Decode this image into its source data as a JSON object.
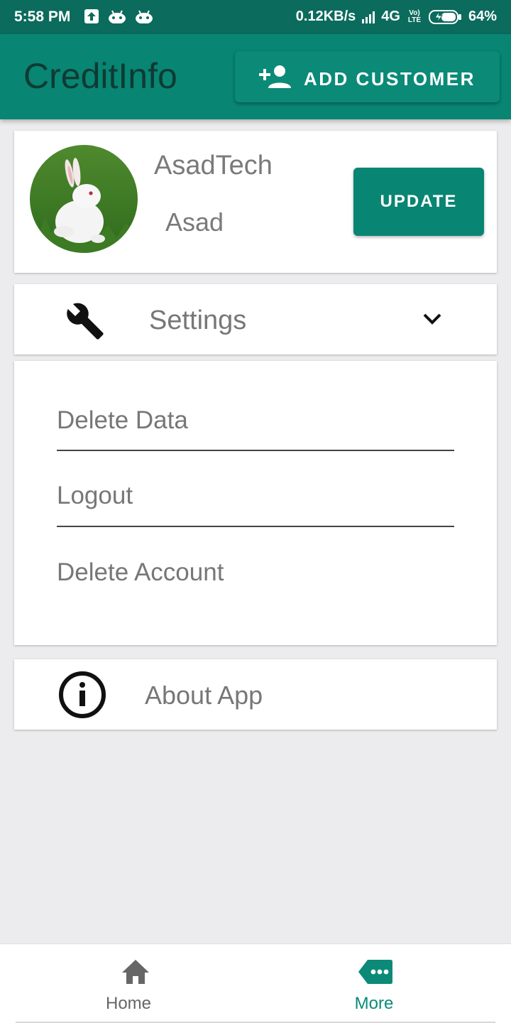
{
  "status_bar": {
    "time": "5:58 PM",
    "network_speed": "0.12KB/s",
    "network_type": "4G",
    "volte": "Vo) LTE",
    "battery": "64%"
  },
  "app_bar": {
    "title": "CreditInfo",
    "add_customer_label": "ADD CUSTOMER"
  },
  "profile": {
    "company": "AsadTech",
    "owner": "Asad",
    "update_label": "UPDATE"
  },
  "settings": {
    "label": "Settings",
    "icon": "wrench-icon",
    "expanded": true
  },
  "settings_menu": [
    {
      "label": "Delete Data"
    },
    {
      "label": "Logout"
    },
    {
      "label": "Delete Account"
    }
  ],
  "about": {
    "label": "About App",
    "icon": "info-icon"
  },
  "bottom_nav": {
    "items": [
      {
        "label": "Home",
        "icon": "home-icon",
        "active": false
      },
      {
        "label": "More",
        "icon": "more-icon",
        "active": true
      }
    ]
  },
  "colors": {
    "status_bar": "#0b6b5d",
    "primary": "#088573",
    "title_text": "#0e3a33",
    "background": "#ececee"
  }
}
